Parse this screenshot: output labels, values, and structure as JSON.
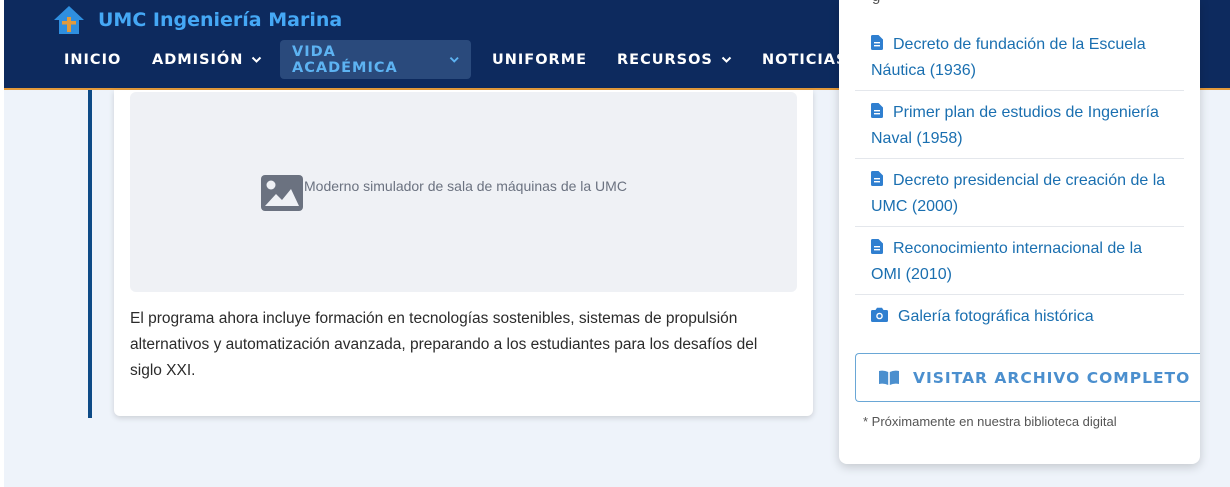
{
  "header": {
    "title": "UMC Ingeniería Marina",
    "logo_icon": "home-anchor-icon",
    "nav": [
      {
        "label": "INICIO",
        "has_dropdown": false
      },
      {
        "label": "ADMISIÓN",
        "has_dropdown": true
      },
      {
        "label": "VIDA ACADÉMICA",
        "has_dropdown": true,
        "active": true
      },
      {
        "label": "UNIFORME",
        "has_dropdown": false
      },
      {
        "label": "RECURSOS",
        "has_dropdown": true
      },
      {
        "label": "NOTICIAS",
        "has_dropdown": false
      }
    ]
  },
  "main": {
    "image_caption": "Moderno simulador de sala de máquinas de la UMC",
    "image_icon": "image-icon",
    "paragraph": "El programa ahora incluye formación en tecnologías sostenibles, sistemas de propulsión alternativos y automatización avanzada, preparando a los estudiantes para los desafíos del siglo XXI."
  },
  "panel": {
    "cut_off_text": "g",
    "documents": [
      {
        "label": "Decreto de fundación de la Escuela Náutica (1936)",
        "icon": "file-icon"
      },
      {
        "label": "Primer plan de estudios de Ingeniería Naval (1958)",
        "icon": "file-icon"
      },
      {
        "label": "Decreto presidencial de creación de la UMC (2000)",
        "icon": "file-icon"
      },
      {
        "label": "Reconocimiento internacional de la OMI (2010)",
        "icon": "file-icon"
      },
      {
        "label": "Galería fotográfica histórica",
        "icon": "camera-icon"
      }
    ],
    "archive_button": "VISITAR ARCHIVO COMPLETO",
    "archive_icon": "book-icon",
    "note": "* Próximamente en nuestra biblioteca digital"
  },
  "colors": {
    "header_bg": "#0d2a5e",
    "brand": "#45a8f5",
    "accent_orange": "#e39a3b",
    "link_blue": "#1a6fb0",
    "page_bg": "#eef3fa"
  }
}
